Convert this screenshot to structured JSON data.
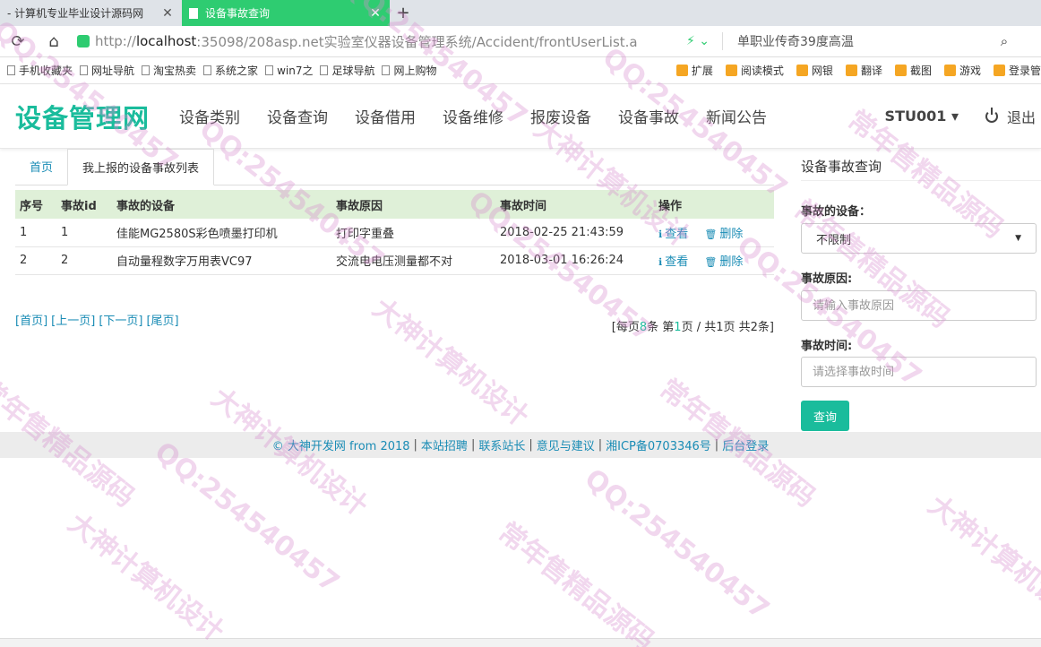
{
  "browser": {
    "tabs": [
      {
        "title": "- 计算机专业毕业设计源码网",
        "active": false
      },
      {
        "title": "设备事故查询",
        "active": true
      }
    ],
    "newtab_label": "+",
    "url_prefix": "http://",
    "url_host": "localhost",
    "url_rest": ":35098/208asp.net实验室仪器设备管理系统/Accident/frontUserList.a",
    "search_hint": "单职业传奇39度高温",
    "bookmarks": [
      "手机收藏夹",
      "网址导航",
      "淘宝热卖",
      "系统之家",
      "win7之",
      "足球导航",
      "网上购物"
    ],
    "toolbar_right": [
      "扩展",
      "阅读模式",
      "网银",
      "翻译",
      "截图",
      "游戏",
      "登录管"
    ]
  },
  "site": {
    "brand": "设备管理网",
    "nav": [
      "设备类别",
      "设备查询",
      "设备借用",
      "设备维修",
      "报废设备",
      "设备事故",
      "新闻公告"
    ],
    "user": "STU001 ▾",
    "logout": "退出"
  },
  "content": {
    "tabs": [
      {
        "label": "首页",
        "active": false
      },
      {
        "label": "我上报的设备事故列表",
        "active": true
      }
    ],
    "table": {
      "headers": [
        "序号",
        "事故id",
        "事故的设备",
        "事故原因",
        "事故时间",
        "操作"
      ],
      "rows": [
        {
          "no": "1",
          "id": "1",
          "device": "佳能MG2580S彩色喷墨打印机",
          "reason": "打印字重叠",
          "time": "2018-02-25 21:43:59"
        },
        {
          "no": "2",
          "id": "2",
          "device": "自动量程数字万用表VC97",
          "reason": "交流电电压测量都不对",
          "time": "2018-03-01 16:26:24"
        }
      ],
      "action_view": "查看",
      "action_delete": "删除"
    },
    "pager": {
      "links": [
        "[首页]",
        "[上一页]",
        "[下一页]",
        "[尾页]"
      ],
      "info_prefix": "[每页",
      "per_page": "8",
      "info_mid1": "条 第",
      "current_page": "1",
      "info_mid2": "页 / 共",
      "total_pages": "1",
      "info_mid3": "页 共",
      "total_items": "2",
      "info_suffix": "条]"
    }
  },
  "search_panel": {
    "title": "设备事故查询",
    "device_label": "事故的设备：",
    "device_selected": "不限制",
    "reason_label": "事故原因:",
    "reason_placeholder": "请输入事故原因",
    "time_label": "事故时间:",
    "time_placeholder": "请选择事故时间",
    "query_button": "查询"
  },
  "footer": {
    "items": [
      "© 大神开发网 from 2018",
      "本站招聘",
      "联系站长",
      "意见与建议",
      "湘ICP备0703346号",
      "后台登录"
    ]
  },
  "watermark": {
    "texts": [
      "大神计算机设计",
      "QQ:254540457",
      "常年售精品源码"
    ]
  },
  "colors": {
    "accent": "#1abc9c",
    "link": "#1a8cb5",
    "tab_active": "#2ecc71",
    "table_header": "#dff0d8"
  }
}
